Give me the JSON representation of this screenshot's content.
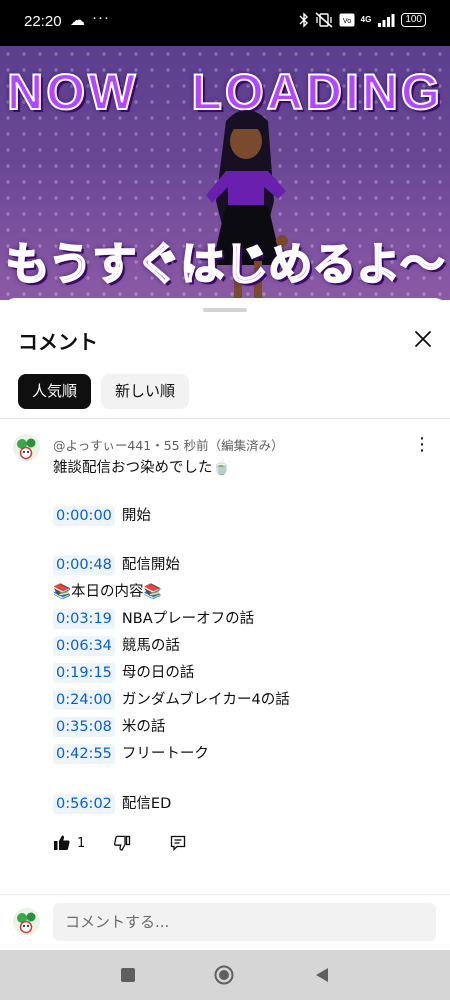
{
  "status_bar": {
    "time": "22:20",
    "cloud_icon": "☁",
    "more_dots": "···",
    "network": "4G",
    "battery": "100"
  },
  "video": {
    "title_top": "NOW　LOADING",
    "title_bottom": "もうすぐはじめるよ〜"
  },
  "sheet": {
    "title": "コメント",
    "tabs": [
      {
        "label": "人気順",
        "active": true
      },
      {
        "label": "新しい順",
        "active": false
      }
    ]
  },
  "comment": {
    "meta": "@よっすぃー441・55 秒前（編集済み）",
    "intro": "雑談配信おつ染めでした🍵",
    "start_ts": "0:00:00",
    "start_label": "開始",
    "begin_ts": "0:00:48",
    "begin_label": "配信開始",
    "today_contents": "📚本日の内容📚",
    "chapters": [
      {
        "ts": "0:03:19",
        "label": "NBAプレーオフの話"
      },
      {
        "ts": "0:06:34",
        "label": "競馬の話"
      },
      {
        "ts": "0:19:15",
        "label": "母の日の話"
      },
      {
        "ts": "0:24:00",
        "label": "ガンダムブレイカー4の話"
      },
      {
        "ts": "0:35:08",
        "label": "米の話"
      },
      {
        "ts": "0:42:55",
        "label": "フリートーク"
      }
    ],
    "end_ts": "0:56:02",
    "end_label": "配信ED",
    "like_count": "1"
  },
  "composer": {
    "placeholder": "コメントする..."
  },
  "colors": {
    "timestamp": "#065fd4",
    "timestamp_bg": "#eef4fb",
    "chip_active": "#0f0f0f",
    "chip_inactive": "#f2f2f2"
  }
}
